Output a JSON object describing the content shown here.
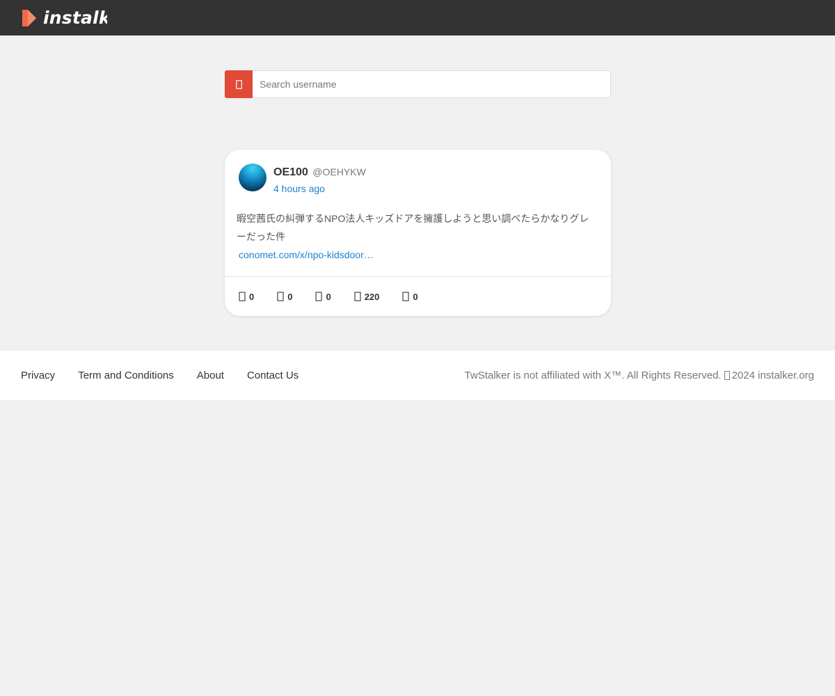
{
  "header": {
    "logo_text": "instalker",
    "logo_icon": "play-bookmark-icon",
    "logo_color": "#f06b4c"
  },
  "search": {
    "icon": "search-icon",
    "placeholder": "Search username",
    "value": "",
    "button_color": "#e04a36"
  },
  "tweet": {
    "display_name": "OE100",
    "handle": "@OEHYKW",
    "time": "4 hours ago",
    "text": "暇空茜氏の糾弾するNPO法人キッズドアを擁護しようと思い調べたらかなりグレーだった件",
    "link": "conomet.com/x/npo-kidsdoor…",
    "link_color": "#1b82d1",
    "stats": [
      {
        "icon": "reply-icon",
        "value": "0"
      },
      {
        "icon": "retweet-icon",
        "value": "0"
      },
      {
        "icon": "like-icon",
        "value": "0"
      },
      {
        "icon": "views-icon",
        "value": "220"
      },
      {
        "icon": "bookmark-icon",
        "value": "0"
      }
    ]
  },
  "footer": {
    "links": [
      "Privacy",
      "Term and Conditions",
      "About",
      "Contact Us"
    ],
    "copyright_left": "TwStalker is not affiliated with X™. All Rights Reserved.",
    "copyright_icon": "copyright-icon",
    "copyright_right": "2024 instalker.org"
  }
}
